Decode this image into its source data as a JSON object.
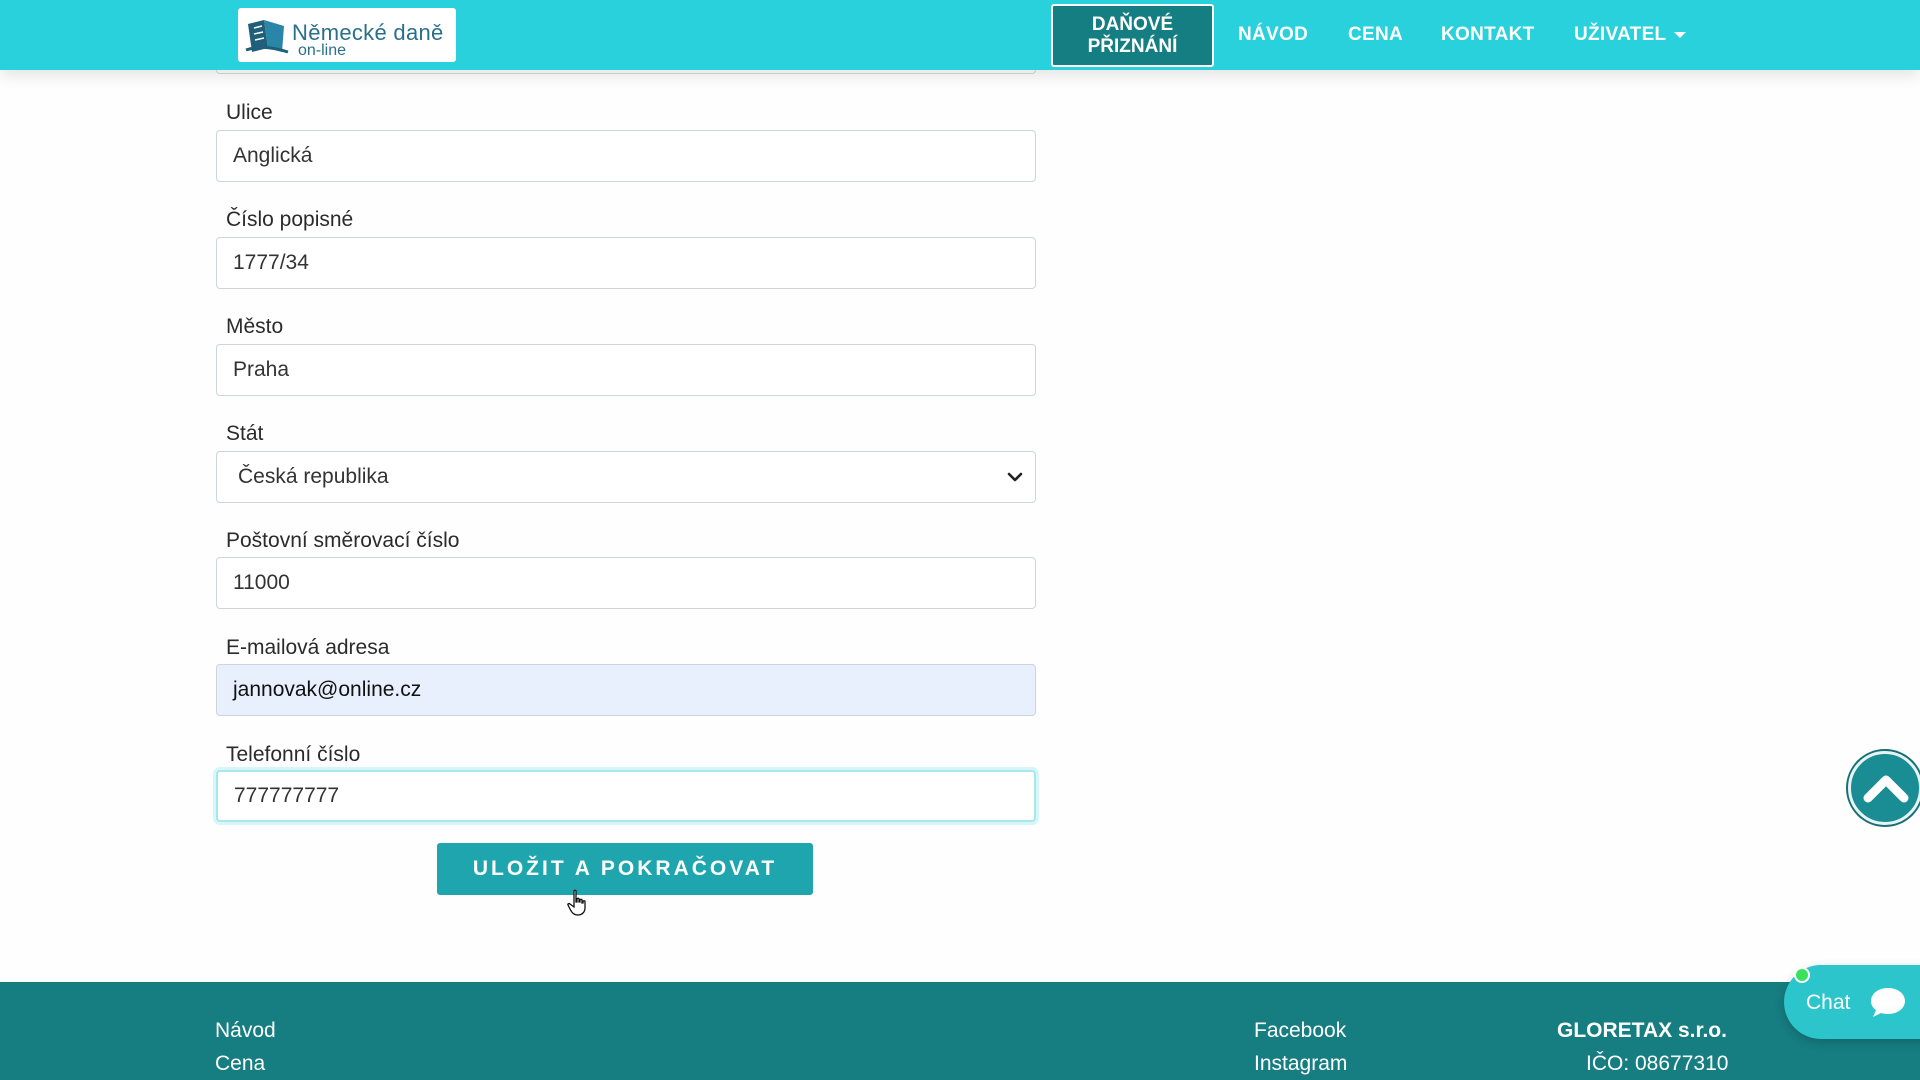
{
  "header": {
    "logo": {
      "line1": "Německé daně",
      "line2": "on-line"
    },
    "nav": {
      "primary_line1": "DAŇOVÉ",
      "primary_line2": "PŘIZNÁNÍ",
      "navod": "NÁVOD",
      "cena": "CENA",
      "kontakt": "KONTAKT",
      "uzivatel": "UŽIVATEL"
    }
  },
  "form": {
    "ulice": {
      "label": "Ulice",
      "value": "Anglická"
    },
    "cislo_popisne": {
      "label": "Číslo popisné",
      "value": "1777/34"
    },
    "mesto": {
      "label": "Město",
      "value": "Praha"
    },
    "stat": {
      "label": "Stát",
      "value": "Česká republika"
    },
    "psc": {
      "label": "Poštovní směrovací číslo",
      "value": "11000"
    },
    "email": {
      "label": "E-mailová adresa",
      "value": "jannovak@online.cz"
    },
    "telefon": {
      "label": "Telefonní číslo",
      "value": "777777777"
    },
    "submit_label": "ULOŽIT A POKRAČOVAT"
  },
  "footer": {
    "links_left": [
      "Návod",
      "Cena"
    ],
    "links_social": [
      "Facebook",
      "Instagram"
    ],
    "company": "GLORETAX s.r.o.",
    "ico": "IČO: 08677310"
  },
  "chat": {
    "label": "Chat"
  },
  "colors": {
    "header_bg": "#29d1dc",
    "primary_nav_bg": "#157e82",
    "button_bg": "#1fa5ae",
    "footer_bg": "#167d80",
    "autofill_bg": "#e8f0fe"
  },
  "icons": {
    "logo": "book-logo-icon",
    "select": "chevron-down-icon",
    "scroll": "chevron-up-icon",
    "chat": "chat-bubble-icon",
    "cursor": "hand-pointer-icon"
  }
}
